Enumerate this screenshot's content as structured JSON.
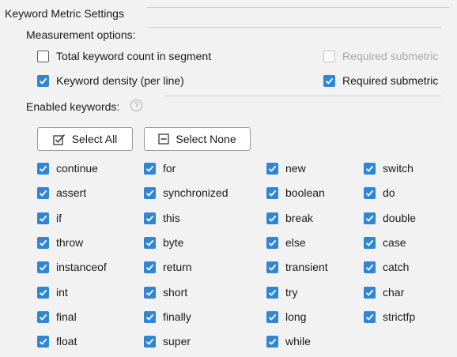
{
  "title": "Keyword Metric Settings",
  "measurement": {
    "label": "Measurement options:",
    "total_count": {
      "label": "Total keyword count in segment",
      "checked": false
    },
    "total_required": {
      "label": "Required submetric",
      "checked": false,
      "enabled": false
    },
    "density": {
      "label": "Keyword density (per line)",
      "checked": true
    },
    "density_required": {
      "label": "Required submetric",
      "checked": true,
      "enabled": true
    }
  },
  "keywords_section": {
    "label": "Enabled keywords:",
    "help_icon": "help-icon",
    "select_all": "Select All",
    "select_none": "Select None"
  },
  "keywords": [
    [
      "continue",
      "for",
      "new",
      "switch"
    ],
    [
      "assert",
      "synchronized",
      "boolean",
      "do"
    ],
    [
      "if",
      "this",
      "break",
      "double"
    ],
    [
      "throw",
      "byte",
      "else",
      "case"
    ],
    [
      "instanceof",
      "return",
      "transient",
      "catch"
    ],
    [
      "int",
      "short",
      "try",
      "char"
    ],
    [
      "final",
      "finally",
      "long",
      "strictfp"
    ],
    [
      "float",
      "super",
      "while"
    ]
  ],
  "colors": {
    "accent": "#2f86d4",
    "background": "#f2f2f2"
  }
}
